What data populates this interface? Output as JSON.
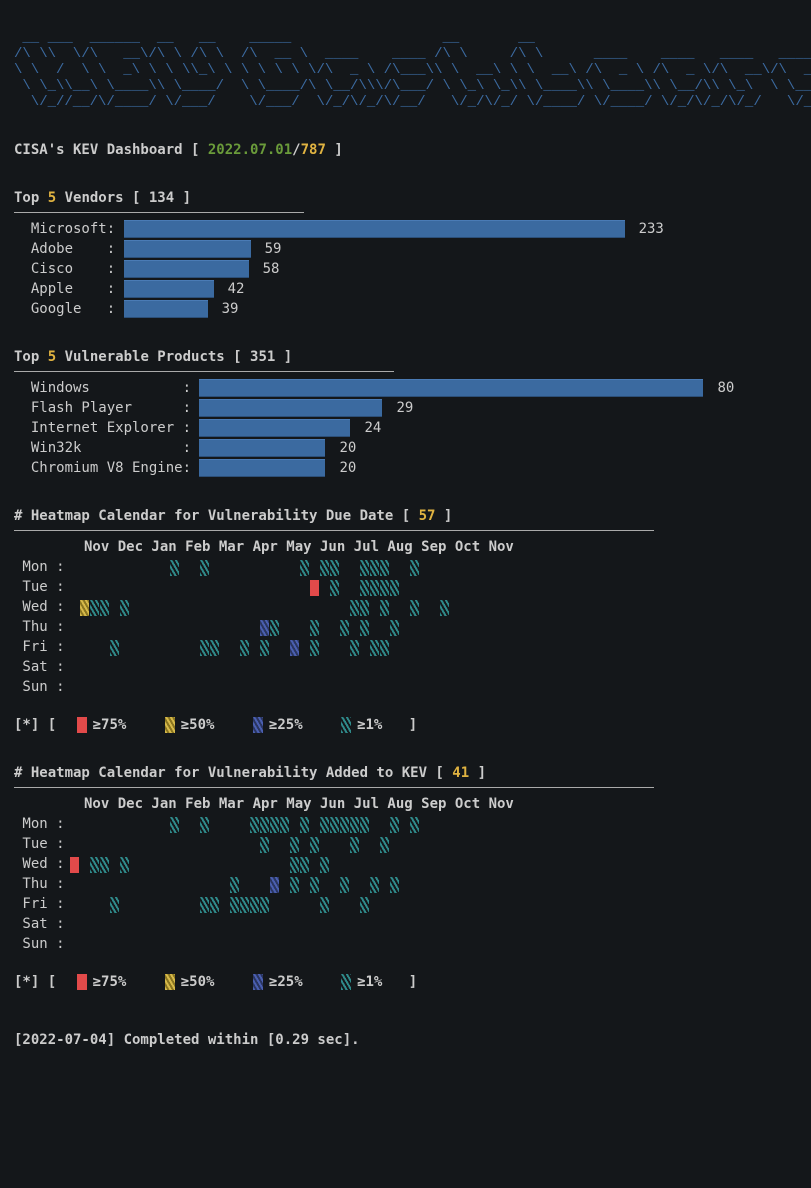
{
  "ascii_title": " __ ___  ______  __   __    _____                  __       __                                  __ \n/\\ \\\\  \\/\\   __\\/\\ \\ /\\ \\  /\\  __ \\  ____    ____ /\\ \\     /\\ \\      ____    ____   ____   ____/\\ \\\n\\ \\  /  \\ \\  _\\ \\ \\ \\\\_\\ \\ \\ \\ \\ \\ \\/\\  _ \\ /\\___\\\\ \\  __\\ \\ \\  __\\ /\\  _ \\ /\\  _ \\/\\  __\\/\\  _\\\\ \\\n \\ \\_\\\\__\\ \\____\\\\ \\____/  \\ \\____/\\ \\__/\\\\\\/\\___/ \\ \\_\\ \\_\\\\ \\____\\\\ \\____\\\\ \\__/\\\\ \\_\\  \\ \\___/\\\\\n  \\/_//__/\\/____/ \\/___/    \\/___/  \\/_/\\/_/\\/__/   \\/_/\\/_/ \\/____/ \\/____/ \\/_/\\/_/\\/_/   \\/__/\\/",
  "header": {
    "prefix": "CISA's KEV Dashboard [ ",
    "date": "2022.07.01",
    "sep": "/",
    "count": "787",
    "suffix": " ]"
  },
  "vendors": {
    "title_prefix": "Top ",
    "title_num": "5",
    "title_mid": " Vendors [ ",
    "title_count": "134",
    "title_suffix": " ]"
  },
  "products": {
    "title_prefix": "Top ",
    "title_num": "5",
    "title_mid": " Vulnerable Products [ ",
    "title_count": "351",
    "title_suffix": " ]"
  },
  "heatmap_due": {
    "title_prefix": "# Heatmap Calendar for Vulnerability Due Date [ ",
    "title_count": "57",
    "title_suffix": " ]"
  },
  "heatmap_added": {
    "title_prefix": "# Heatmap Calendar for Vulnerability Added to KEV [ ",
    "title_count": "41",
    "title_suffix": " ]"
  },
  "months_line": "Nov Dec Jan Feb Mar Apr May Jun Jul Aug Sep Oct Nov",
  "days": [
    "Mon :",
    "Tue :",
    "Wed :",
    "Thu :",
    "Fri :",
    "Sat :",
    "Sun :"
  ],
  "legend": {
    "open": "[*]  [",
    "l4": "≥75%",
    "l3": "≥50%",
    "l2": "≥25%",
    "l1": "≥1%",
    "close": "]"
  },
  "footer": "[2022-07-04] Completed within [0.29 sec].",
  "chart_data": [
    {
      "type": "bar",
      "title": "Top 5 Vendors",
      "total": 134,
      "categories": [
        "Microsoft",
        "Adobe",
        "Cisco",
        "Apple",
        "Google"
      ],
      "values": [
        233,
        59,
        58,
        42,
        39
      ],
      "xlabel": "",
      "ylabel": "",
      "ylim": [
        0,
        233
      ]
    },
    {
      "type": "bar",
      "title": "Top 5 Vulnerable Products",
      "total": 351,
      "categories": [
        "Windows",
        "Flash Player",
        "Internet Explorer",
        "Win32k",
        "Chromium V8 Engine"
      ],
      "values": [
        80,
        29,
        24,
        20,
        20
      ],
      "xlabel": "",
      "ylabel": "",
      "ylim": [
        0,
        80
      ]
    },
    {
      "type": "heatmap",
      "title": "Heatmap Calendar for Vulnerability Due Date",
      "weeks_shown": 57,
      "months": [
        "Nov",
        "Dec",
        "Jan",
        "Feb",
        "Mar",
        "Apr",
        "May",
        "Jun",
        "Jul",
        "Aug",
        "Sep",
        "Oct",
        "Nov"
      ],
      "day_labels": [
        "Mon",
        "Tue",
        "Wed",
        "Thu",
        "Fri",
        "Sat",
        "Sun"
      ],
      "legend_levels": {
        "4": "≥75%",
        "3": "≥50%",
        "2": "≥25%",
        "1": "≥1%"
      },
      "grid_levels": [
        [
          0,
          0,
          0,
          0,
          0,
          0,
          0,
          0,
          0,
          0,
          1,
          0,
          0,
          1,
          0,
          0,
          0,
          0,
          0,
          0,
          0,
          0,
          0,
          1,
          0,
          1,
          1,
          0,
          0,
          1,
          1,
          1,
          0,
          0,
          1,
          0,
          0,
          0,
          0,
          0,
          0,
          0,
          0,
          0,
          0,
          0,
          0,
          0,
          0,
          0,
          0,
          0
        ],
        [
          0,
          0,
          0,
          0,
          0,
          0,
          0,
          0,
          0,
          0,
          0,
          0,
          0,
          0,
          0,
          0,
          0,
          0,
          0,
          0,
          0,
          0,
          0,
          0,
          4,
          0,
          1,
          0,
          0,
          1,
          1,
          1,
          1,
          0,
          0,
          0,
          0,
          0,
          0,
          0,
          0,
          0,
          0,
          0,
          0,
          0,
          0,
          0,
          0,
          0,
          0,
          0
        ],
        [
          0,
          3,
          1,
          1,
          0,
          1,
          0,
          0,
          0,
          0,
          0,
          0,
          0,
          0,
          0,
          0,
          0,
          0,
          0,
          0,
          0,
          0,
          0,
          0,
          0,
          0,
          0,
          0,
          1,
          1,
          0,
          1,
          0,
          0,
          1,
          0,
          0,
          1,
          0,
          0,
          0,
          0,
          0,
          0,
          0,
          0,
          0,
          0,
          0,
          0,
          0,
          0
        ],
        [
          0,
          0,
          0,
          0,
          0,
          0,
          0,
          0,
          0,
          0,
          0,
          0,
          0,
          0,
          0,
          0,
          0,
          0,
          0,
          2,
          1,
          0,
          0,
          0,
          1,
          0,
          0,
          1,
          0,
          1,
          0,
          0,
          1,
          0,
          0,
          0,
          0,
          0,
          0,
          0,
          0,
          0,
          0,
          0,
          0,
          0,
          0,
          0,
          0,
          0,
          0,
          0
        ],
        [
          0,
          0,
          0,
          0,
          1,
          0,
          0,
          0,
          0,
          0,
          0,
          0,
          0,
          1,
          1,
          0,
          0,
          1,
          0,
          1,
          0,
          0,
          2,
          0,
          1,
          0,
          0,
          0,
          1,
          0,
          1,
          1,
          0,
          0,
          0,
          0,
          0,
          0,
          0,
          0,
          0,
          0,
          0,
          0,
          0,
          0,
          0,
          0,
          0,
          0,
          0,
          0
        ],
        [
          0,
          0,
          0,
          0,
          0,
          0,
          0,
          0,
          0,
          0,
          0,
          0,
          0,
          0,
          0,
          0,
          0,
          0,
          0,
          0,
          0,
          0,
          0,
          0,
          0,
          0,
          0,
          0,
          0,
          0,
          0,
          0,
          0,
          0,
          0,
          0,
          0,
          0,
          0,
          0,
          0,
          0,
          0,
          0,
          0,
          0,
          0,
          0,
          0,
          0,
          0,
          0
        ],
        [
          0,
          0,
          0,
          0,
          0,
          0,
          0,
          0,
          0,
          0,
          0,
          0,
          0,
          0,
          0,
          0,
          0,
          0,
          0,
          0,
          0,
          0,
          0,
          0,
          0,
          0,
          0,
          0,
          0,
          0,
          0,
          0,
          0,
          0,
          0,
          0,
          0,
          0,
          0,
          0,
          0,
          0,
          0,
          0,
          0,
          0,
          0,
          0,
          0,
          0,
          0,
          0
        ]
      ]
    },
    {
      "type": "heatmap",
      "title": "Heatmap Calendar for Vulnerability Added to KEV",
      "weeks_shown": 41,
      "months": [
        "Nov",
        "Dec",
        "Jan",
        "Feb",
        "Mar",
        "Apr",
        "May",
        "Jun",
        "Jul",
        "Aug",
        "Sep",
        "Oct",
        "Nov"
      ],
      "day_labels": [
        "Mon",
        "Tue",
        "Wed",
        "Thu",
        "Fri",
        "Sat",
        "Sun"
      ],
      "legend_levels": {
        "4": "≥75%",
        "3": "≥50%",
        "2": "≥25%",
        "1": "≥1%"
      },
      "grid_levels": [
        [
          0,
          0,
          0,
          0,
          0,
          0,
          0,
          0,
          0,
          0,
          1,
          0,
          0,
          1,
          0,
          0,
          0,
          0,
          1,
          1,
          1,
          1,
          0,
          1,
          0,
          1,
          1,
          1,
          1,
          1,
          0,
          0,
          1,
          0,
          1,
          0,
          0,
          0,
          0,
          0,
          0,
          0,
          0,
          0,
          0,
          0,
          0,
          0,
          0,
          0,
          0,
          0
        ],
        [
          0,
          0,
          0,
          0,
          0,
          0,
          0,
          0,
          0,
          0,
          0,
          0,
          0,
          0,
          0,
          0,
          0,
          0,
          0,
          1,
          0,
          0,
          1,
          0,
          1,
          0,
          0,
          0,
          1,
          0,
          0,
          1,
          0,
          0,
          0,
          0,
          0,
          0,
          0,
          0,
          0,
          0,
          0,
          0,
          0,
          0,
          0,
          0,
          0,
          0,
          0,
          0
        ],
        [
          4,
          0,
          1,
          1,
          0,
          1,
          0,
          0,
          0,
          0,
          0,
          0,
          0,
          0,
          0,
          0,
          0,
          0,
          0,
          0,
          0,
          0,
          1,
          1,
          0,
          1,
          0,
          0,
          0,
          0,
          0,
          0,
          0,
          0,
          0,
          0,
          0,
          0,
          0,
          0,
          0,
          0,
          0,
          0,
          0,
          0,
          0,
          0,
          0,
          0,
          0,
          0
        ],
        [
          0,
          0,
          0,
          0,
          0,
          0,
          0,
          0,
          0,
          0,
          0,
          0,
          0,
          0,
          0,
          0,
          1,
          0,
          0,
          0,
          2,
          0,
          1,
          0,
          1,
          0,
          0,
          1,
          0,
          0,
          1,
          0,
          1,
          0,
          0,
          0,
          0,
          0,
          0,
          0,
          0,
          0,
          0,
          0,
          0,
          0,
          0,
          0,
          0,
          0,
          0,
          0
        ],
        [
          0,
          0,
          0,
          0,
          1,
          0,
          0,
          0,
          0,
          0,
          0,
          0,
          0,
          1,
          1,
          0,
          1,
          1,
          1,
          1,
          0,
          0,
          0,
          0,
          0,
          1,
          0,
          0,
          0,
          1,
          0,
          0,
          0,
          0,
          0,
          0,
          0,
          0,
          0,
          0,
          0,
          0,
          0,
          0,
          0,
          0,
          0,
          0,
          0,
          0,
          0,
          0
        ],
        [
          0,
          0,
          0,
          0,
          0,
          0,
          0,
          0,
          0,
          0,
          0,
          0,
          0,
          0,
          0,
          0,
          0,
          0,
          0,
          0,
          0,
          0,
          0,
          0,
          0,
          0,
          0,
          0,
          0,
          0,
          0,
          0,
          0,
          0,
          0,
          0,
          0,
          0,
          0,
          0,
          0,
          0,
          0,
          0,
          0,
          0,
          0,
          0,
          0,
          0,
          0,
          0
        ],
        [
          0,
          0,
          0,
          0,
          0,
          0,
          0,
          0,
          0,
          0,
          0,
          0,
          0,
          0,
          0,
          0,
          0,
          0,
          0,
          0,
          0,
          0,
          0,
          0,
          0,
          0,
          0,
          0,
          0,
          0,
          0,
          0,
          0,
          0,
          0,
          0,
          0,
          0,
          0,
          0,
          0,
          0,
          0,
          0,
          0,
          0,
          0,
          0,
          0,
          0,
          0,
          0
        ]
      ]
    }
  ]
}
